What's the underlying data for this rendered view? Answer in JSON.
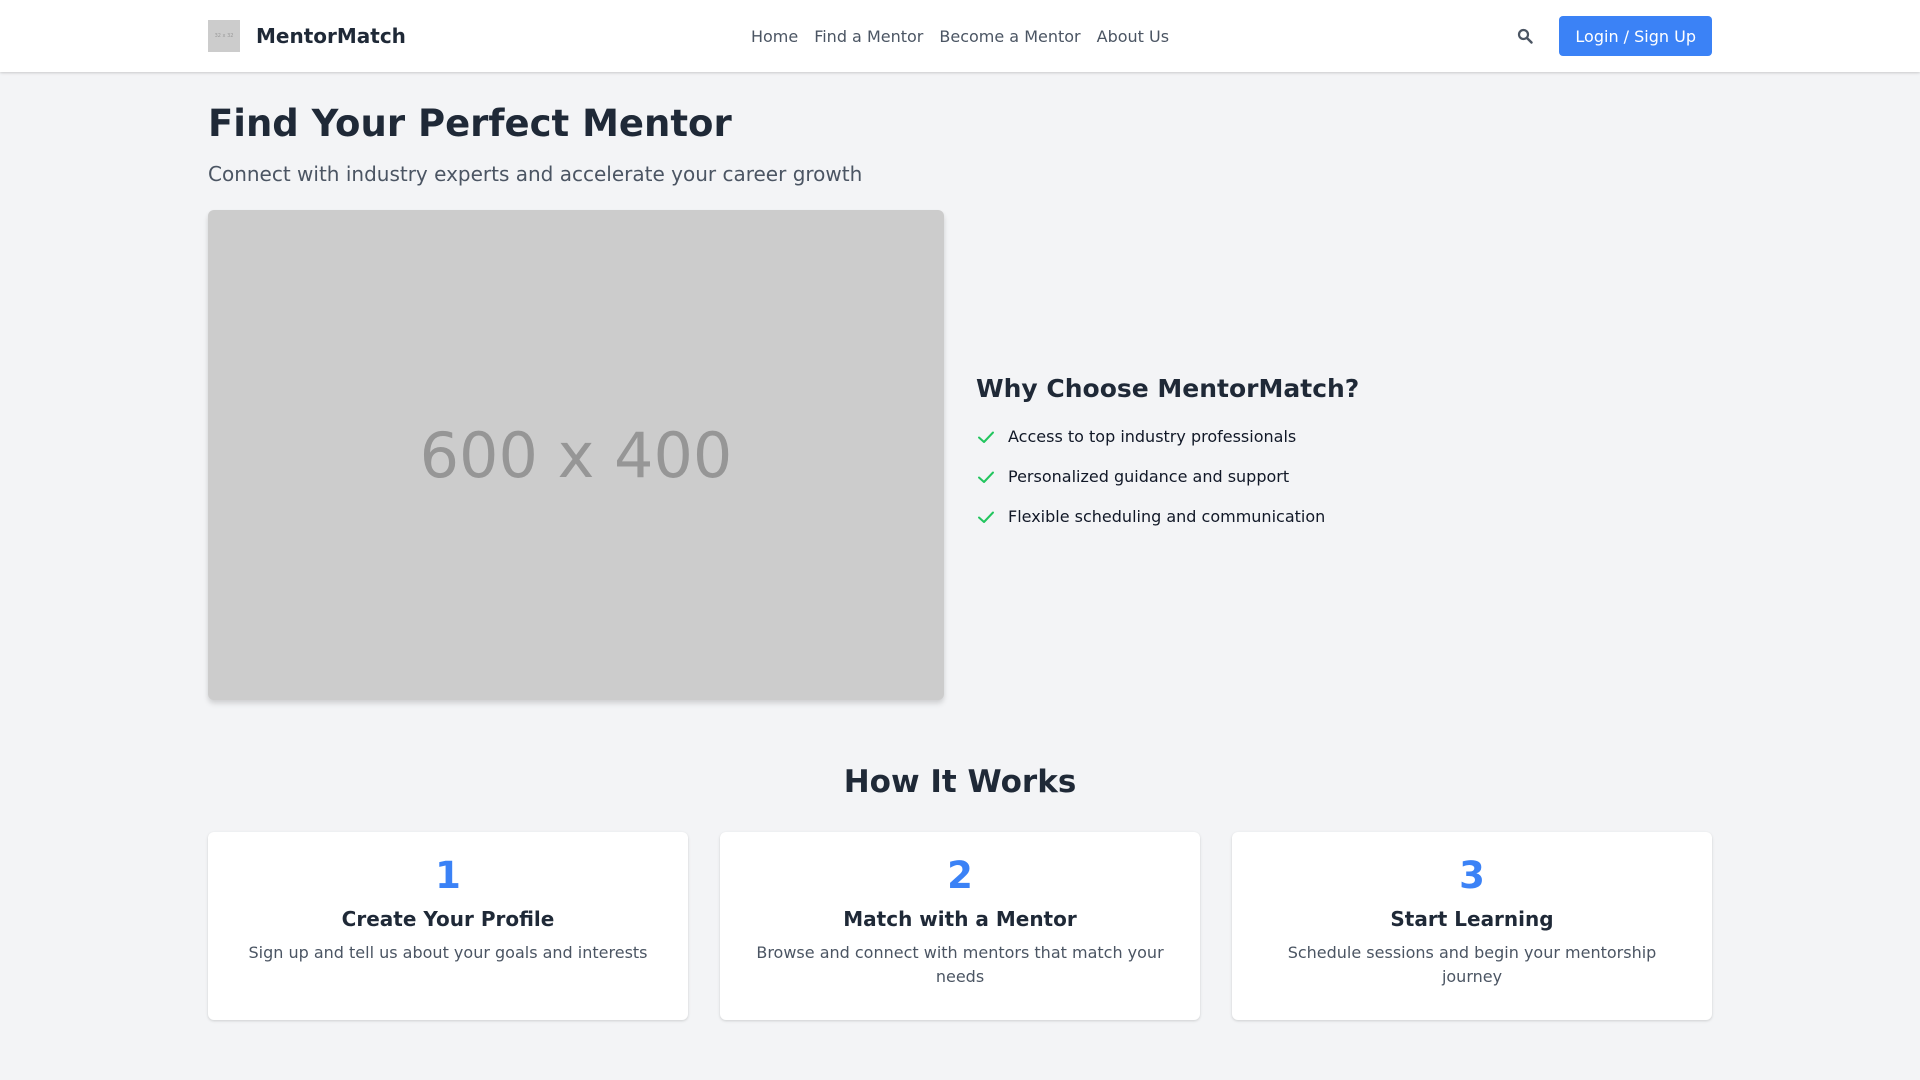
{
  "nav": {
    "logo_text": "32 x 32",
    "brand": "MentorMatch",
    "links": [
      "Home",
      "Find a Mentor",
      "Become a Mentor",
      "About Us"
    ],
    "login_label": "Login / Sign Up"
  },
  "hero": {
    "title": "Find Your Perfect Mentor",
    "subtitle": "Connect with industry experts and accelerate your career growth",
    "image_text": "600 x 400"
  },
  "why": {
    "title": "Why Choose MentorMatch?",
    "items": [
      "Access to top industry professionals",
      "Personalized guidance and support",
      "Flexible scheduling and communication"
    ]
  },
  "how": {
    "title": "How It Works",
    "steps": [
      {
        "number": "1",
        "title": "Create Your Profile",
        "desc": "Sign up and tell us about your goals and interests"
      },
      {
        "number": "2",
        "title": "Match with a Mentor",
        "desc": "Browse and connect with mentors that match your needs"
      },
      {
        "number": "3",
        "title": "Start Learning",
        "desc": "Schedule sessions and begin your mentorship journey"
      }
    ]
  },
  "colors": {
    "accent": "#3b82f6",
    "check": "#22c55e",
    "background": "#f3f4f6"
  },
  "icons": {
    "search": "search-icon",
    "check": "check-icon"
  }
}
